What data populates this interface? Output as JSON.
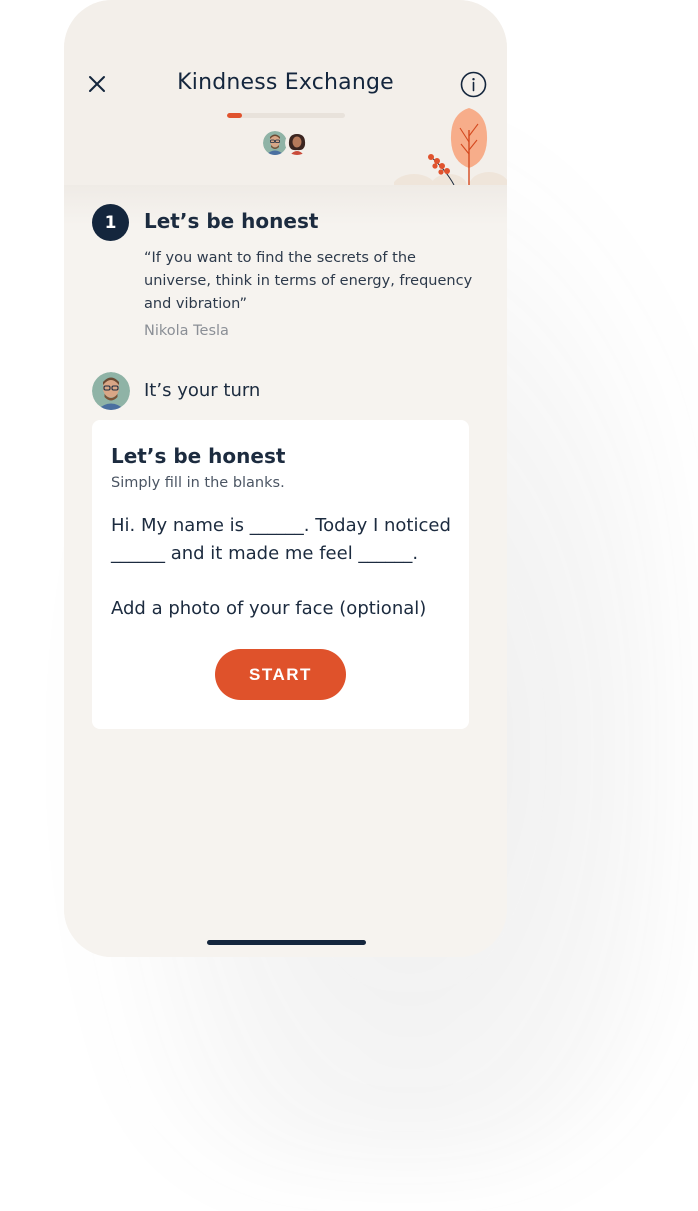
{
  "header": {
    "title": "Kindness Exchange",
    "close_icon": "close-icon",
    "info_icon": "info-icon",
    "progress": 0.13,
    "progress_color": "#e0532e"
  },
  "step": {
    "number": "1",
    "title": "Let’s be honest",
    "quote": "“If you want to find the secrets of the universe, think in terms of energy, frequency and vibration”",
    "author": "Nikola Tesla"
  },
  "turn": {
    "label": "It’s your turn"
  },
  "card": {
    "title": "Let’s be honest",
    "subtitle": "Simply fill in the blanks.",
    "body": "Hi. My name is ______. Today I noticed ______ and it made me feel ______.",
    "photo_prompt": "Add a photo of your face (optional)",
    "start_label": "START",
    "accent": "#df522b"
  }
}
